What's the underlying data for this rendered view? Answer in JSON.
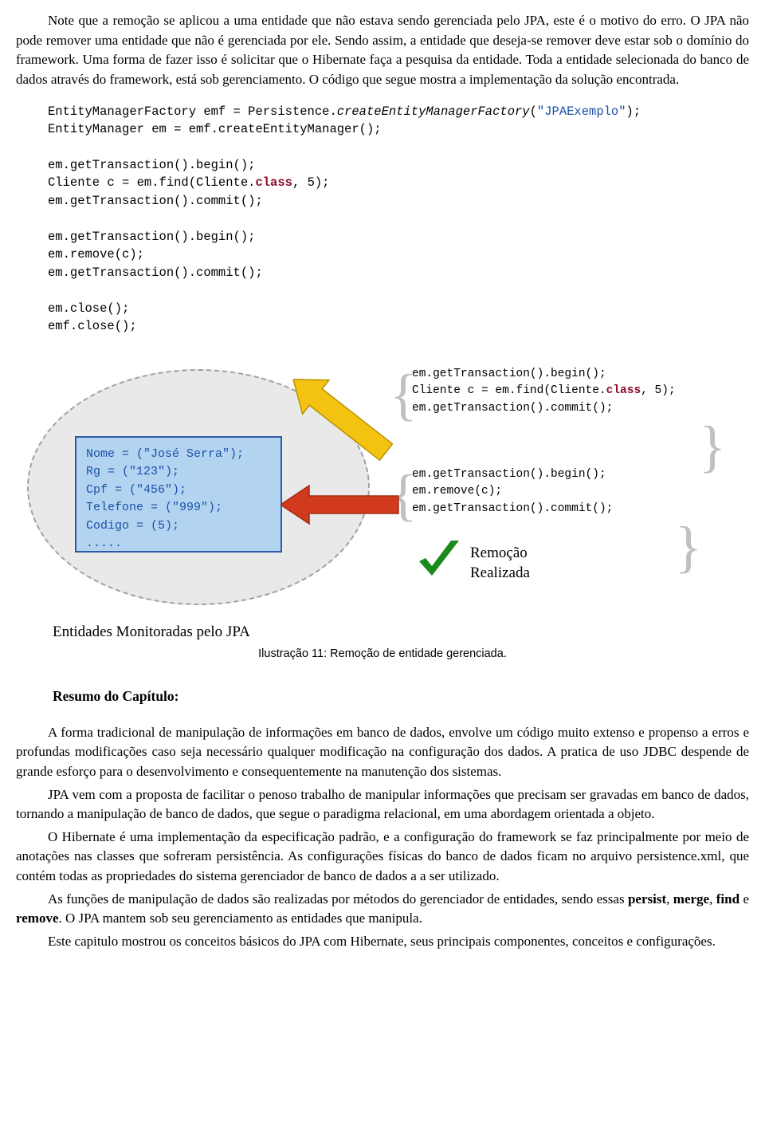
{
  "intro": {
    "p1": "Note que a remoção se aplicou a uma entidade que não estava sendo gerenciada pelo JPA,  este é o motivo do erro. O JPA não pode remover uma entidade que não é gerenciada por ele. Sendo assim, a entidade que deseja-se remover deve estar sob o domínio do framework. Uma forma de fazer isso é solicitar que o Hibernate faça a pesquisa da entidade. Toda a entidade selecionada do banco de dados através do framework, está sob gerenciamento. O código que segue mostra a  implementação da solução encontrada."
  },
  "code1": {
    "l1a": "EntityManagerFactory emf = Persistence.",
    "l1b": "createEntityManagerFactory",
    "l1c": "(",
    "l1d": "\"JPAExemplo\"",
    "l1e": ");",
    "l2": "EntityManager em = emf.createEntityManager();",
    "l3": "em.getTransaction().begin();",
    "l4a": "Cliente c = em.find(Cliente.",
    "l4b": "class",
    "l4c": ", 5);",
    "l5": "em.getTransaction().commit();",
    "l6": "em.getTransaction().begin();",
    "l7": "em.remove(c);",
    "l8": "em.getTransaction().commit();",
    "l9": "em.close();",
    "l10": "emf.close();"
  },
  "entity": {
    "l1a": "Nome = (",
    "l1b": "\"José Serra\"",
    "l1c": ");",
    "l2a": "Rg = (",
    "l2b": "\"123\"",
    "l2c": ");",
    "l3a": "Cpf = (",
    "l3b": "\"456\"",
    "l3c": ");",
    "l4a": "Telefone = (",
    "l4b": "\"999\"",
    "l4c": ");",
    "l5": "Codigo = (5);",
    "l6": "....."
  },
  "snippet1": {
    "l1": "em.getTransaction().begin();",
    "l2a": "Cliente c = em.find(Cliente.",
    "l2b": "class",
    "l2c": ", 5);",
    "l3": "em.getTransaction().commit();"
  },
  "snippet2": {
    "l1": "em.getTransaction().begin();",
    "l2": "em.remove(c);",
    "l3": "em.getTransaction().commit();"
  },
  "checklabel": {
    "l1": "Remoção",
    "l2": "Realizada"
  },
  "caption": "Entidades Monitoradas pelo JPA",
  "figure": "Ilustração 11: Remoção de entidade gerenciada.",
  "section": "Resumo do Capítulo:",
  "summary": {
    "p1": "A forma tradicional de manipulação de informações em banco de dados, envolve um código muito extenso e propenso a erros e profundas modificações caso seja necessário qualquer modificação na configuração dos dados. A pratica de uso JDBC despende de grande esforço para o desenvolvimento e consequentemente na manutenção dos sistemas.",
    "p2": "JPA vem com a proposta de facilitar o penoso trabalho de manipular informações que precisam ser gravadas em banco de dados, tornando a manipulação de banco de dados, que segue o paradigma relacional, em uma abordagem orientada a objeto.",
    "p3": "O Hibernate é uma implementação da especificação padrão, e a configuração do framework se faz principalmente por meio de anotações nas classes que sofreram persistência. As configurações físicas do banco de dados ficam no arquivo persistence.xml, que contém todas as propriedades do sistema gerenciador de banco de dados a a ser utilizado.",
    "p4a": "As funções de manipulação de dados são realizadas por métodos do gerenciador de entidades, sendo essas ",
    "p4b": "persist",
    "p4c": ", ",
    "p4d": "merge",
    "p4e": ", ",
    "p4f": "find",
    "p4g": " e ",
    "p4h": "remove",
    "p4i": ". O JPA mantem sob seu gerenciamento as entidades que manipula.",
    "p5": "Este capitulo mostrou os conceitos básicos do JPA com Hibernate, seus principais componentes, conceitos e configurações."
  }
}
